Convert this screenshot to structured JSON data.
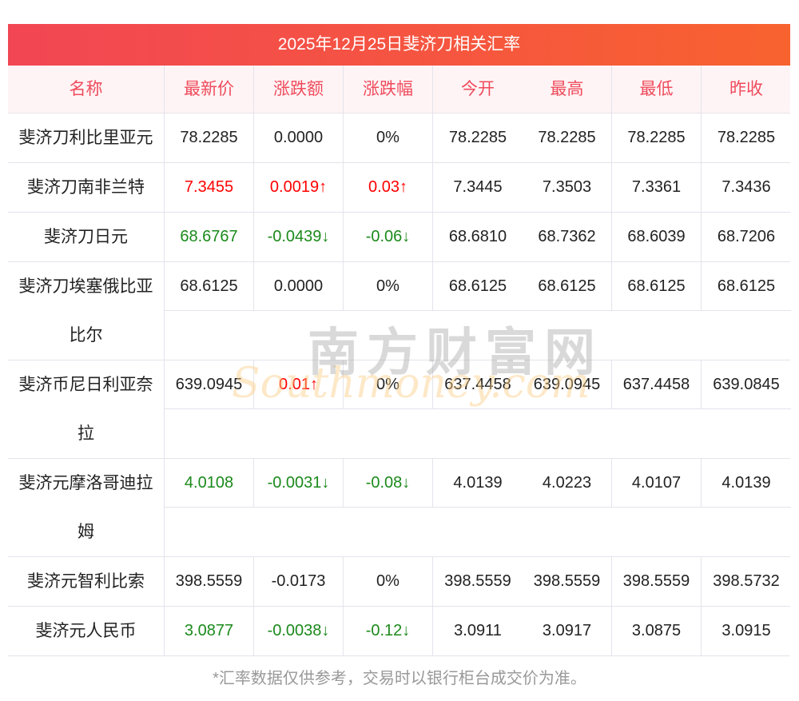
{
  "title": "2025年12月25日斐济刀相关汇率",
  "headers": [
    "名称",
    "最新价",
    "涨跌额",
    "涨跌幅",
    "今开",
    "最高",
    "最低",
    "昨收"
  ],
  "rows": [
    {
      "name": "斐济刀利比里亚元",
      "vals": [
        "78.2285",
        "0.0000",
        "0%",
        "78.2285",
        "78.2285",
        "78.2285",
        "78.2285"
      ],
      "trend": ""
    },
    {
      "name": "斐济刀南非兰特",
      "vals": [
        "7.3455",
        "0.0019↑",
        "0.03↑",
        "7.3445",
        "7.3503",
        "7.3361",
        "7.3436"
      ],
      "trend": "up"
    },
    {
      "name": "斐济刀日元",
      "vals": [
        "68.6767",
        "-0.0439↓",
        "-0.06↓",
        "68.6810",
        "68.7362",
        "68.6039",
        "68.7206"
      ],
      "trend": "down"
    },
    {
      "name": "斐济刀埃塞俄比亚比尔",
      "vals": [
        "68.6125",
        "0.0000",
        "0%",
        "68.6125",
        "68.6125",
        "68.6125",
        "68.6125"
      ],
      "trend": ""
    },
    {
      "name": "斐济币尼日利亚奈拉",
      "vals": [
        "639.0945",
        "0.01↑",
        "0%",
        "637.4458",
        "639.0945",
        "637.4458",
        "639.0845"
      ],
      "trend": "up2"
    },
    {
      "name": "斐济元摩洛哥迪拉姆",
      "vals": [
        "4.0108",
        "-0.0031↓",
        "-0.08↓",
        "4.0139",
        "4.0223",
        "4.0107",
        "4.0139"
      ],
      "trend": "down"
    },
    {
      "name": "斐济元智利比索",
      "vals": [
        "398.5559",
        "-0.0173",
        "0%",
        "398.5559",
        "398.5559",
        "398.5559",
        "398.5732"
      ],
      "trend": ""
    },
    {
      "name": "斐济元人民币",
      "vals": [
        "3.0877",
        "-0.0038↓",
        "-0.12↓",
        "3.0911",
        "3.0917",
        "3.0875",
        "3.0915"
      ],
      "trend": "down"
    }
  ],
  "watermark": {
    "cn": "南方财富网",
    "en": "Southmoney.com"
  },
  "note": "*汇率数据仅供参考，交易时以银行柜台成交价为准。",
  "colors": {
    "up": "#ff0000",
    "down": "#1b8a1b",
    "accent": "#f24654"
  }
}
